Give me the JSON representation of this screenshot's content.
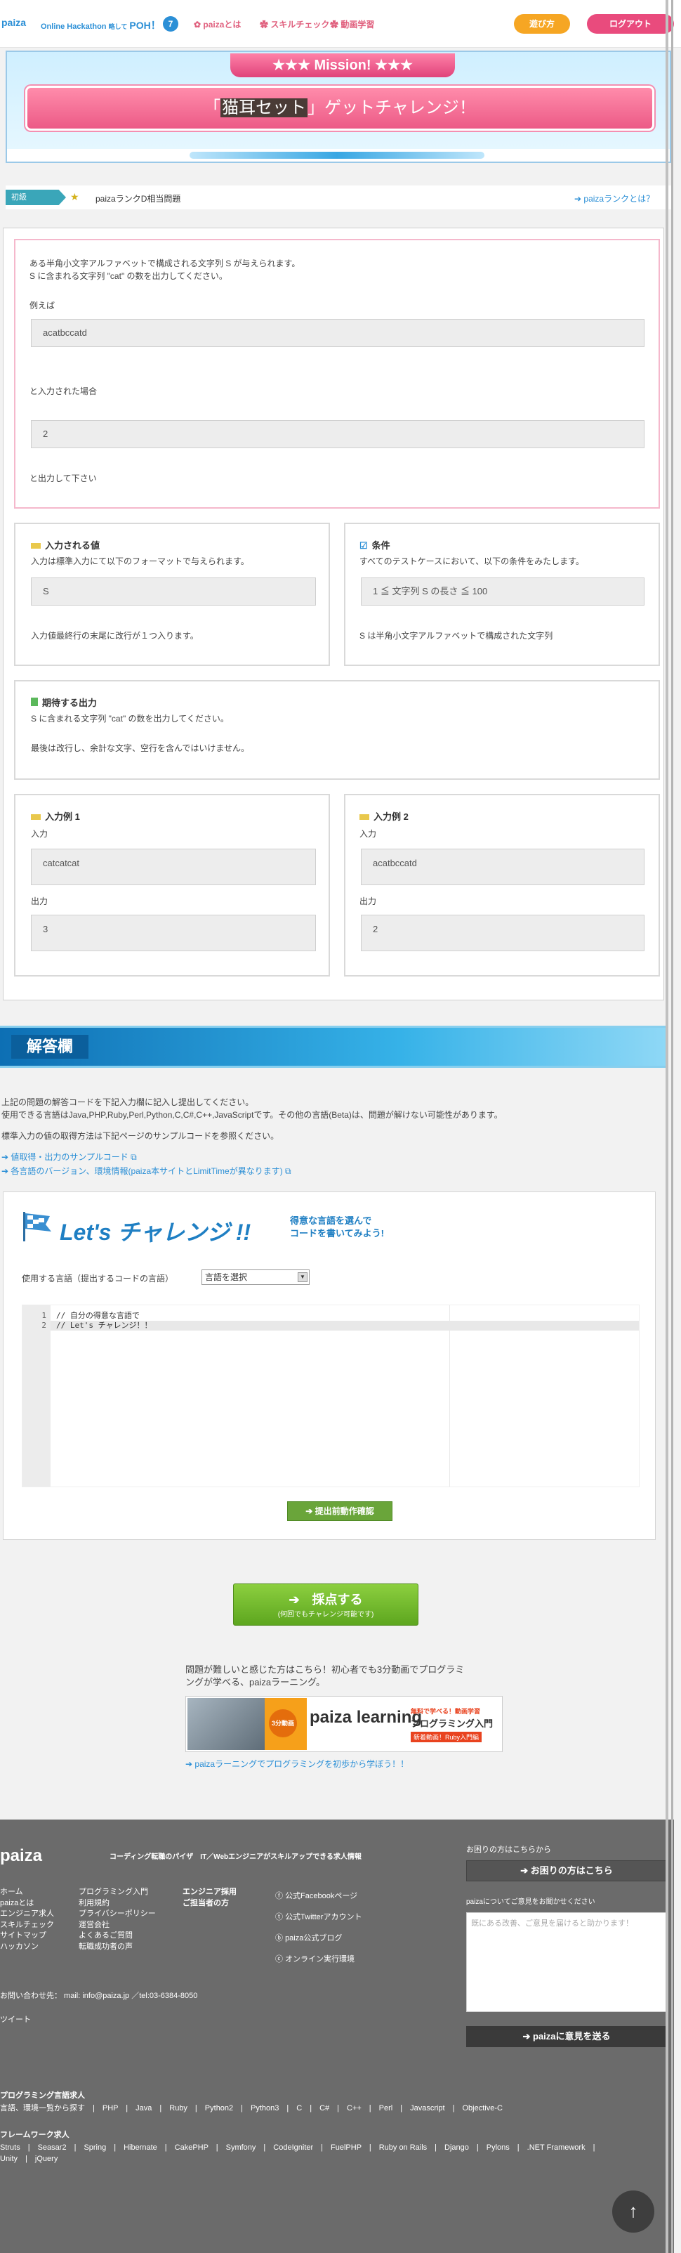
{
  "header": {
    "logo": "paiza",
    "event_title": "Online Hackathon",
    "event_suffix": "略して",
    "poh": "POH！",
    "poh_num": "7",
    "nav": [
      "paizaとは",
      "スキルチェック",
      "動画学習"
    ],
    "btn_play": "遊び方",
    "btn_logout": "ログアウト"
  },
  "mission": {
    "tab": "Mission!",
    "open_bracket": "「",
    "highlight": "猫耳セット",
    "rest": "」ゲットチャレンジ！"
  },
  "rank": {
    "tag": "初級",
    "text": "paizaランクD相当問題",
    "link": "paizaランクとは？"
  },
  "problem": {
    "desc1": "ある半角小文字アルファベットで構成される文字列 S が与えられます。",
    "desc2": "S に含まれる文字列 \"cat\" の数を出力してください。",
    "example_label": "例えば",
    "example_input": "acatbccatd",
    "when_input": "と入力された場合",
    "example_output": "2",
    "please_output": "と出力して下さい"
  },
  "input_box": {
    "title": "入力される値",
    "desc": "入力は標準入力にて以下のフォーマットで与えられます。",
    "value": "S",
    "note": "入力値最終行の末尾に改行が１つ入ります。"
  },
  "condition_box": {
    "title": "条件",
    "desc": "すべてのテストケースにおいて、以下の条件をみたします。",
    "value": "1 ≦ 文字列 S の長さ ≦ 100",
    "note": "S は半角小文字アルファベットで構成された文字列"
  },
  "expected_box": {
    "title": "期待する出力",
    "desc1": "S に含まれる文字列 \"cat\" の数を出力してください。",
    "desc2": "最後は改行し、余計な文字、空行を含んではいけません。"
  },
  "example1": {
    "title": "入力例 1",
    "in_label": "入力",
    "in_value": "catcatcat",
    "out_label": "出力",
    "out_value": "3"
  },
  "example2": {
    "title": "入力例 2",
    "in_label": "入力",
    "in_value": "acatbccatd",
    "out_label": "出力",
    "out_value": "2"
  },
  "answer": {
    "title": "解答欄",
    "line1": "上記の問題の解答コードを下記入力欄に記入し提出してください。",
    "line2": "使用できる言語はJava,PHP,Ruby,Perl,Python,C,C#,C++,JavaScriptです。その他の言語(Beta)は、問題が解けない可能性があります。",
    "line3": "標準入力の値の取得方法は下記ページのサンプルコードを参照ください。",
    "link1": "値取得・出力のサンプルコード",
    "link2": "各言語のバージョン、環境情報(paiza本サイトとLimitTimeが異なります)"
  },
  "challenge": {
    "title": "Let's チャレンジ !!",
    "sub1": "得意な言語を選んで",
    "sub2": "コードを書いてみよう!",
    "lang_label": "使用する言語（提出するコードの言語）",
    "lang_select": "言語を選択",
    "code_lines": [
      "// 自分の得意な言語で",
      "// Let's チャレンジ！！"
    ],
    "line_numbers": [
      "1",
      "2"
    ],
    "check_button": "提出前動作確認",
    "submit_button": "採点する",
    "submit_sub": "(何回でもチャレンジ可能です)"
  },
  "learning": {
    "text1": "問題が難しいと感じた方はこちら！初心者でも3分動画でプログラミ",
    "text2": "ングが学べる、paizaラーニング。",
    "banner_logo": "paiza learning",
    "banner_badge": "3分動画",
    "banner_text1": "無料で学べる！動画学習",
    "banner_text2": "プログラミング入門",
    "banner_text3": "新着動画！Ruby入門編",
    "link": "paizaラーニングでプログラミングを初歩から学ぼう！！"
  },
  "footer": {
    "logo": "paiza",
    "tagline": "コーディング転職のパイザ　IT／Webエンジニアがスキルアップできる求人情報",
    "col1": [
      "ホーム",
      "paizaとは",
      "エンジニア求人",
      "スキルチェック",
      "サイトマップ",
      "ハッカソン"
    ],
    "col2": [
      "プログラミング入門",
      "利用規約",
      "プライバシーポリシー",
      "運営会社",
      "よくあるご質問",
      "転職成功者の声"
    ],
    "col3": [
      "エンジニア採用",
      "ご担当者の方"
    ],
    "social": [
      "公式Facebookページ",
      "公式Twitterアカウント",
      "paiza公式ブログ",
      "オンライン実行環境"
    ],
    "contact": "お問い合わせ先： mail: info@paiza.jp ／tel:03-6384-8050",
    "tweet": "ツイート",
    "help_label": "お困りの方はこちらから",
    "help_button": "お困りの方はこちら",
    "opinion_label": "paizaについてご意見をお聞かせください",
    "opinion_placeholder": "既にある改善、ご意見を届けると助かります！",
    "send_button": "paizaに意見を送る",
    "lang_title": "プログラミング言語求人",
    "langs": [
      "言語、環境一覧から探す",
      "PHP",
      "Java",
      "Ruby",
      "Python2",
      "Python3",
      "C",
      "C#",
      "C++",
      "Perl",
      "Javascript",
      "Objective-C"
    ],
    "fw_title": "フレームワーク求人",
    "fws": [
      "Struts",
      "Seasar2",
      "Spring",
      "Hibernate",
      "CakePHP",
      "Symfony",
      "CodeIgniter",
      "FuelPHP",
      "Ruby on Rails",
      "Django",
      "Pylons",
      ".NET Framework",
      "Unity",
      "jQuery"
    ]
  }
}
